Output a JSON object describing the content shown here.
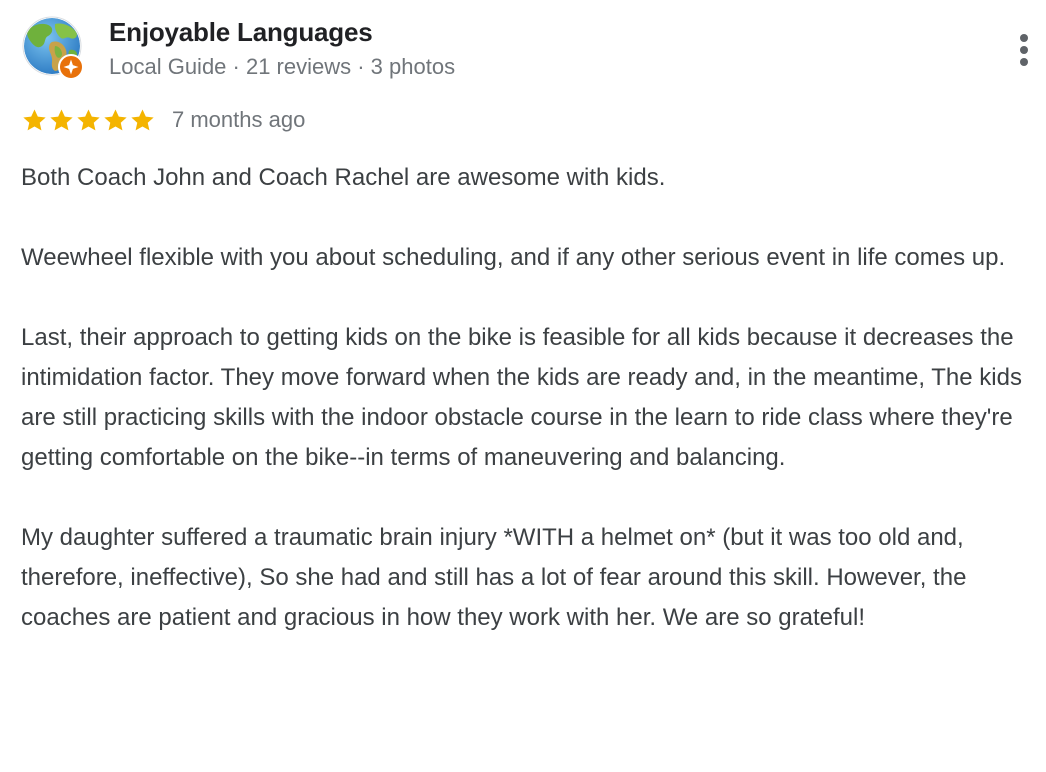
{
  "reviewer": {
    "name": "Enjoyable Languages",
    "meta": "Local Guide · 21 reviews · 3 photos",
    "avatar_icon": "globe-icon",
    "badge_icon": "local-guide-star-icon"
  },
  "menu": {
    "icon": "more-vert-icon"
  },
  "rating": {
    "stars": 5,
    "max": 5,
    "star_color": "#f4b400",
    "date": "7 months ago"
  },
  "review": {
    "paragraphs": [
      "Both Coach John and Coach Rachel are awesome with kids.",
      "Weewheel flexible with you about scheduling, and if any other serious event in life comes up.",
      "Last, their approach to getting kids on the bike is feasible for all kids because it decreases the intimidation factor. They move forward when the kids are ready and, in the meantime, The kids are still practicing skills with the indoor obstacle course in the learn to ride class where they're getting comfortable on the bike--in terms of maneuvering and balancing.",
      "My daughter suffered a traumatic brain injury *WITH a helmet on* (but it was too old and, therefore, ineffective), So she had and still has a lot of fear around this skill. However, the coaches are patient and gracious in how they work with her. We are so grateful!"
    ]
  },
  "colors": {
    "name_text": "#202124",
    "meta_text": "#70757a",
    "body_text": "#3c4043",
    "badge_orange": "#e8710a"
  }
}
